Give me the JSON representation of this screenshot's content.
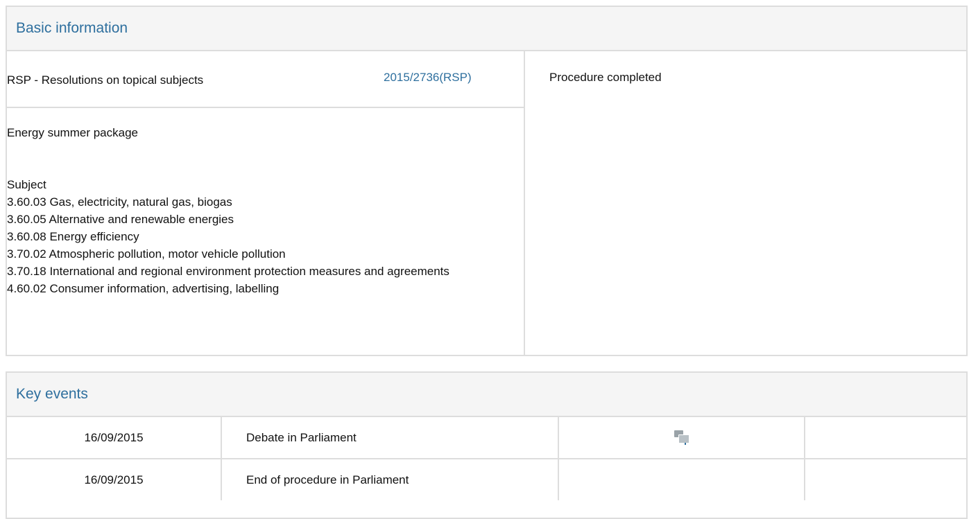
{
  "basic": {
    "title": "Basic information",
    "procedure_type": "RSP - Resolutions on topical subjects",
    "reference": "2015/2736(RSP)",
    "status": "Procedure completed",
    "procedure_title": "Energy summer package",
    "subject_heading": "Subject",
    "subjects": [
      "3.60.03 Gas, electricity, natural gas, biogas",
      "3.60.05 Alternative and renewable energies",
      "3.60.08 Energy efficiency",
      "3.70.02 Atmospheric pollution, motor vehicle pollution",
      "3.70.18 International and regional environment protection measures and agreements",
      "4.60.02 Consumer information, advertising, labelling"
    ]
  },
  "events": {
    "title": "Key events",
    "rows": [
      {
        "date": "16/09/2015",
        "event": "Debate in Parliament",
        "icon": "debate-icon"
      },
      {
        "date": "16/09/2015",
        "event": "End of procedure in Parliament"
      }
    ]
  },
  "colors": {
    "accent": "#2e6f9e",
    "border": "#dddddd",
    "header_bg": "#f5f5f5"
  }
}
